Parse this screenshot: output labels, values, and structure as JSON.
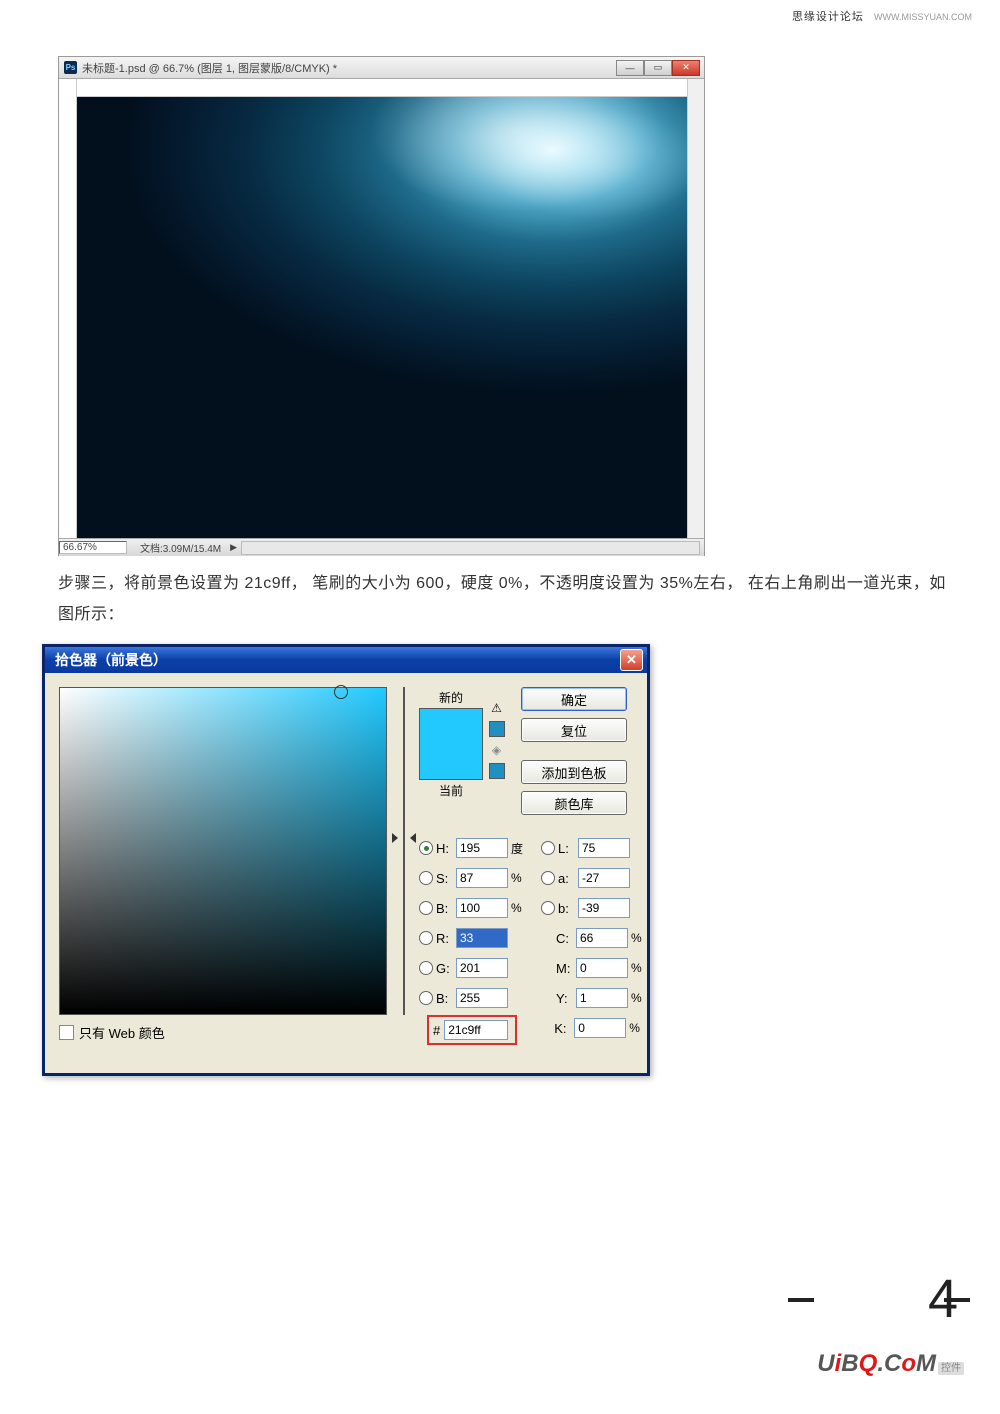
{
  "header": {
    "site": "思缘设计论坛",
    "url": "WWW.MISSYUAN.COM"
  },
  "ps_window": {
    "title": "未标题-1.psd @ 66.7% (图层 1, 图层蒙版/8/CMYK) *",
    "zoom": "66.67%",
    "docinfo": "文档:3.09M/15.4M"
  },
  "step_text": "步骤三，将前景色设置为 21c9ff， 笔刷的大小为 600，硬度 0%，不透明度设置为 35%左右， 在右上角刷出一道光束，如图所示：",
  "color_picker": {
    "title": "拾色器（前景色）",
    "new_label": "新的",
    "current_label": "当前",
    "buttons": {
      "ok": "确定",
      "cancel": "复位",
      "add": "添加到色板",
      "lib": "颜色库"
    },
    "web_only": "只有 Web 颜色",
    "hsb": {
      "H": "195",
      "H_unit": "度",
      "S": "87",
      "B": "100"
    },
    "lab": {
      "L": "75",
      "a": "-27",
      "b": "-39"
    },
    "rgb": {
      "R": "33",
      "G": "201",
      "B": "255"
    },
    "cmyk": {
      "C": "66",
      "M": "0",
      "Y": "1",
      "K": "0"
    },
    "hex": "21c9ff"
  },
  "page_number": "4"
}
